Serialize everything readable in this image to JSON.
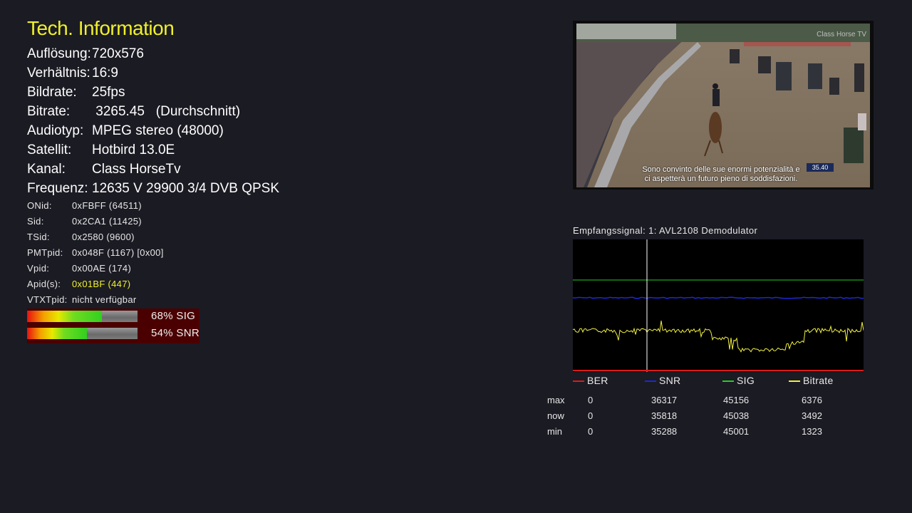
{
  "title": "Tech. Information",
  "main_info": [
    {
      "label": "Auflösung:",
      "value": "720x576"
    },
    {
      "label": "Verhältnis:",
      "value": "16:9"
    },
    {
      "label": "Bildrate:",
      "value": "25fps"
    },
    {
      "label": "Bitrate:",
      "value": " 3265.45   (Durchschnitt)"
    },
    {
      "label": "Audiotyp:",
      "value": "MPEG stereo (48000)"
    },
    {
      "label": "Satellit:",
      "value": "Hotbird 13.0E"
    },
    {
      "label": "Kanal:",
      "value": "Class HorseTv"
    },
    {
      "label": "Frequenz:",
      "value": "12635 V 29900 3/4 DVB QPSK"
    }
  ],
  "pid_info": [
    {
      "label": "ONid:",
      "value": "0xFBFF (64511)"
    },
    {
      "label": "Sid:",
      "value": "0x2CA1 (11425)"
    },
    {
      "label": "TSid:",
      "value": "0x2580 (9600)"
    },
    {
      "label": "PMTpid:",
      "value": "0x048F (1167) [0x00]"
    },
    {
      "label": "Vpid:",
      "value": "0x00AE (174)"
    },
    {
      "label": "Apid(s):",
      "value": "0x01BF (447)",
      "highlight": true
    },
    {
      "label": "VTXTpid:",
      "value": "nicht verfügbar"
    }
  ],
  "meters": [
    {
      "label": "68% SIG",
      "percent": 68
    },
    {
      "label": "54% SNR",
      "percent": 54
    }
  ],
  "video": {
    "subtitle_line1": "Sono convinto delle sue enormi potenzialità e",
    "subtitle_line2": "ci aspetterà un futuro pieno di soddisfazioni.",
    "score": "35.40",
    "logo": "Class Horse TV"
  },
  "signal": {
    "title": "Empfangssignal: 1: AVL2108 Demodulator",
    "legend": [
      {
        "label": "BER",
        "color": "#e01818"
      },
      {
        "label": "SNR",
        "color": "#1a2ad8"
      },
      {
        "label": "SIG",
        "color": "#20d020"
      },
      {
        "label": "Bitrate",
        "color": "#f0f040"
      }
    ],
    "stats": {
      "rows": [
        {
          "name": "max",
          "values": [
            "0",
            "36317",
            "45156",
            "6376"
          ]
        },
        {
          "name": "now",
          "values": [
            "0",
            "35818",
            "45038",
            "3492"
          ]
        },
        {
          "name": "min",
          "values": [
            "0",
            "35288",
            "45001",
            "1323"
          ]
        }
      ]
    }
  }
}
